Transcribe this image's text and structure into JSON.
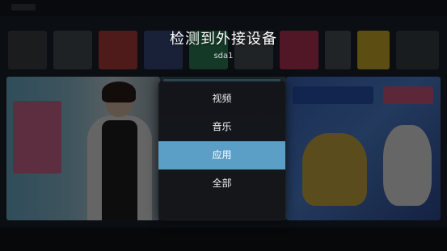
{
  "dialog": {
    "title": "检测到外接设备",
    "subtitle": "sda1"
  },
  "menu": {
    "items": [
      {
        "label": "视频",
        "selected": false
      },
      {
        "label": "音乐",
        "selected": false
      },
      {
        "label": "应用",
        "selected": true
      },
      {
        "label": "全部",
        "selected": false
      }
    ]
  },
  "colors": {
    "highlight": "#5b9fc7",
    "panel": "#121418",
    "title": "#ffffff"
  }
}
